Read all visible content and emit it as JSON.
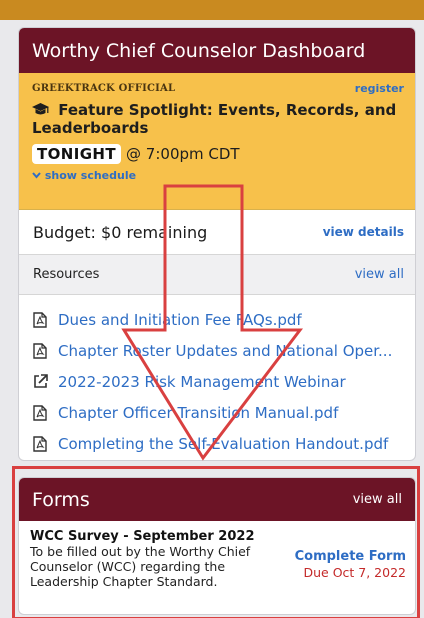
{
  "dashboard": {
    "title": "Worthy Chief Counselor Dashboard",
    "spotlight": {
      "org": "GREEKTRACK OFFICIAL",
      "register_label": "register",
      "cap_icon": "graduation-cap-icon",
      "title": "Feature Spotlight: Events, Records, and Leaderboards",
      "badge": "TONIGHT",
      "time": "@ 7:00pm CDT",
      "schedule_label": "show schedule"
    },
    "budget": {
      "text": "Budget: $0 remaining",
      "details_label": "view details"
    },
    "resources": {
      "title": "Resources",
      "view_all": "view all",
      "items": [
        {
          "label": "Dues and Initiation Fee FAQs.pdf",
          "icon": "pdf-file-icon"
        },
        {
          "label": "Chapter Roster Updates and National Oper...",
          "icon": "pdf-file-icon"
        },
        {
          "label": "2022-2023 Risk Management Webinar",
          "icon": "external-link-icon"
        },
        {
          "label": "Chapter Officer Transition Manual.pdf",
          "icon": "pdf-file-icon"
        },
        {
          "label": "Completing the Self-Evaluation Handout.pdf",
          "icon": "pdf-file-icon"
        }
      ]
    }
  },
  "forms": {
    "title": "Forms",
    "view_all": "view all",
    "item": {
      "title": "WCC Survey - September 2022",
      "description": "To be filled out by the Worthy Chief Counselor (WCC) regarding the Leadership Chapter Standard.",
      "action_label": "Complete Form",
      "due": "Due Oct 7, 2022"
    }
  },
  "colors": {
    "header": "#6c1426",
    "spotlight": "#f7c14b",
    "link": "#2e6dc4",
    "annotation": "#d94040",
    "due": "#c42a2a"
  }
}
